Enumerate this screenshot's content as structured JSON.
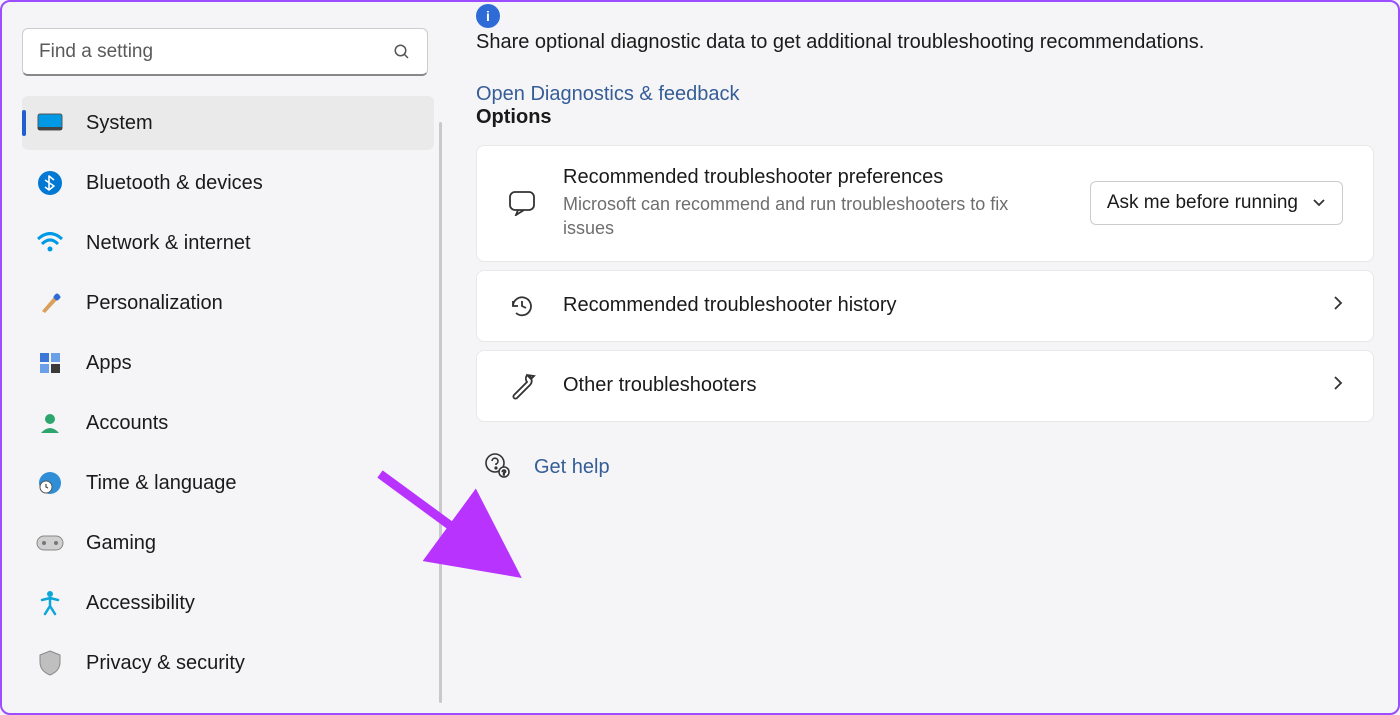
{
  "search": {
    "placeholder": "Find a setting"
  },
  "sidebar": {
    "items": [
      {
        "label": "System",
        "icon": "system",
        "selected": true
      },
      {
        "label": "Bluetooth & devices",
        "icon": "bluetooth"
      },
      {
        "label": "Network & internet",
        "icon": "wifi"
      },
      {
        "label": "Personalization",
        "icon": "brush"
      },
      {
        "label": "Apps",
        "icon": "apps"
      },
      {
        "label": "Accounts",
        "icon": "account"
      },
      {
        "label": "Time & language",
        "icon": "clock-globe"
      },
      {
        "label": "Gaming",
        "icon": "gaming"
      },
      {
        "label": "Accessibility",
        "icon": "accessibility"
      },
      {
        "label": "Privacy & security",
        "icon": "shield"
      }
    ]
  },
  "main": {
    "info_text": "Share optional diagnostic data to get additional troubleshooting recommendations.",
    "info_link": "Open Diagnostics & feedback",
    "section_title": "Options",
    "options": [
      {
        "title": "Recommended troubleshooter preferences",
        "desc": "Microsoft can recommend and run troubleshooters to fix issues",
        "dropdown": "Ask me before running",
        "icon": "chat"
      },
      {
        "title": "Recommended troubleshooter history",
        "icon": "history",
        "chevron": true
      },
      {
        "title": "Other troubleshooters",
        "icon": "wrench",
        "chevron": true
      }
    ],
    "help_label": "Get help"
  }
}
